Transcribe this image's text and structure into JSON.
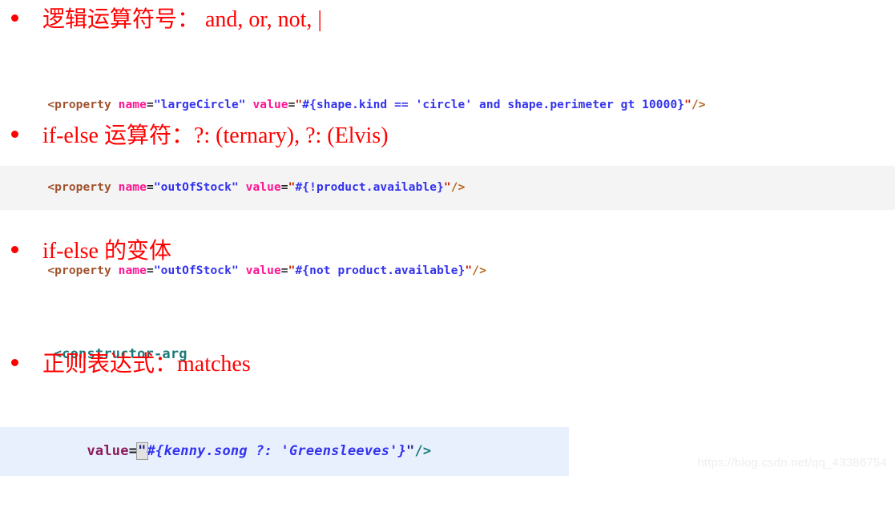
{
  "slide": {
    "background_color": "#ffffff",
    "text_color": "#ff0000",
    "bullets": [
      {
        "id": "logical-operators",
        "text": "逻辑运算符号： and, or, not, |"
      },
      {
        "id": "if-else-operator",
        "text": "if-else 运算符：?: (ternary), ?: (Elvis)"
      },
      {
        "id": "if-else-variant",
        "text": "if-else 的变体"
      },
      {
        "id": "regex-matches",
        "text": "正则表达式：matches"
      }
    ]
  },
  "code_block_properties": {
    "lines": [
      {
        "highlighted": false,
        "tokens": [
          {
            "text": "<property ",
            "style": "tag"
          },
          {
            "text": "name",
            "style": "attr"
          },
          {
            "text": "=",
            "style": "eq"
          },
          {
            "text": "\"largeCircle\"",
            "style": "str-q"
          },
          {
            "text": " ",
            "style": "eq"
          },
          {
            "text": "value",
            "style": "attr"
          },
          {
            "text": "=",
            "style": "eq"
          },
          {
            "text": "\"",
            "style": "quote"
          },
          {
            "text": "#{shape.kind == 'circle' and shape.perimeter gt 10000}",
            "style": "str"
          },
          {
            "text": "\"",
            "style": "quote"
          },
          {
            "text": "/>",
            "style": "close1"
          }
        ],
        "plain": "<property name=\"largeCircle\" value=\"#{shape.kind == 'circle' and shape.perimeter gt 10000}\"/>"
      },
      {
        "highlighted": true,
        "tokens": [
          {
            "text": "<property ",
            "style": "tag"
          },
          {
            "text": "name",
            "style": "attr"
          },
          {
            "text": "=",
            "style": "eq"
          },
          {
            "text": "\"outOfStock\"",
            "style": "str-q"
          },
          {
            "text": " ",
            "style": "eq"
          },
          {
            "text": "value",
            "style": "attr"
          },
          {
            "text": "=",
            "style": "eq"
          },
          {
            "text": "\"",
            "style": "quote"
          },
          {
            "text": "#{!product.available}",
            "style": "str"
          },
          {
            "text": "\"",
            "style": "quote"
          },
          {
            "text": "/>",
            "style": "close1"
          }
        ],
        "plain": "<property name=\"outOfStock\" value=\"#{!product.available}\"/>"
      },
      {
        "highlighted": false,
        "tokens": [
          {
            "text": "<property ",
            "style": "tag"
          },
          {
            "text": "name",
            "style": "attr"
          },
          {
            "text": "=",
            "style": "eq"
          },
          {
            "text": "\"outOfStock\"",
            "style": "str-q"
          },
          {
            "text": " ",
            "style": "eq"
          },
          {
            "text": "value",
            "style": "attr"
          },
          {
            "text": "=",
            "style": "eq"
          },
          {
            "text": "\"",
            "style": "quote"
          },
          {
            "text": "#{not product.available}",
            "style": "str"
          },
          {
            "text": "\"",
            "style": "quote"
          },
          {
            "text": "/>",
            "style": "close1"
          }
        ],
        "plain": "<property name=\"outOfStock\" value=\"#{not product.available}\"/>"
      }
    ]
  },
  "code_block_constructor": {
    "line1_tag": "<constructor-arg",
    "line2": {
      "attr": "value",
      "eq": "=",
      "quote_open": "\"",
      "expression": "#{kenny.song ?: 'Greensleeves'}",
      "quote_close": "\"",
      "self_close": "/>"
    },
    "plain": "<constructor-arg\n    value=\"#{kenny.song ?: 'Greensleeves'}\"/>"
  },
  "watermark": {
    "text": "https://blog.csdn.net/qq_43386754"
  },
  "colors": {
    "bullet_red": "#ff0000",
    "tag_brown": "#a0522d",
    "tag_teal": "#1a7a7a",
    "attr_pink": "#ff1493",
    "string_blue": "#3333ee",
    "highlight_gray": "#f4f4f4",
    "highlight_blue": "#e8f0fe",
    "watermark_gray": "#eeeeee"
  }
}
